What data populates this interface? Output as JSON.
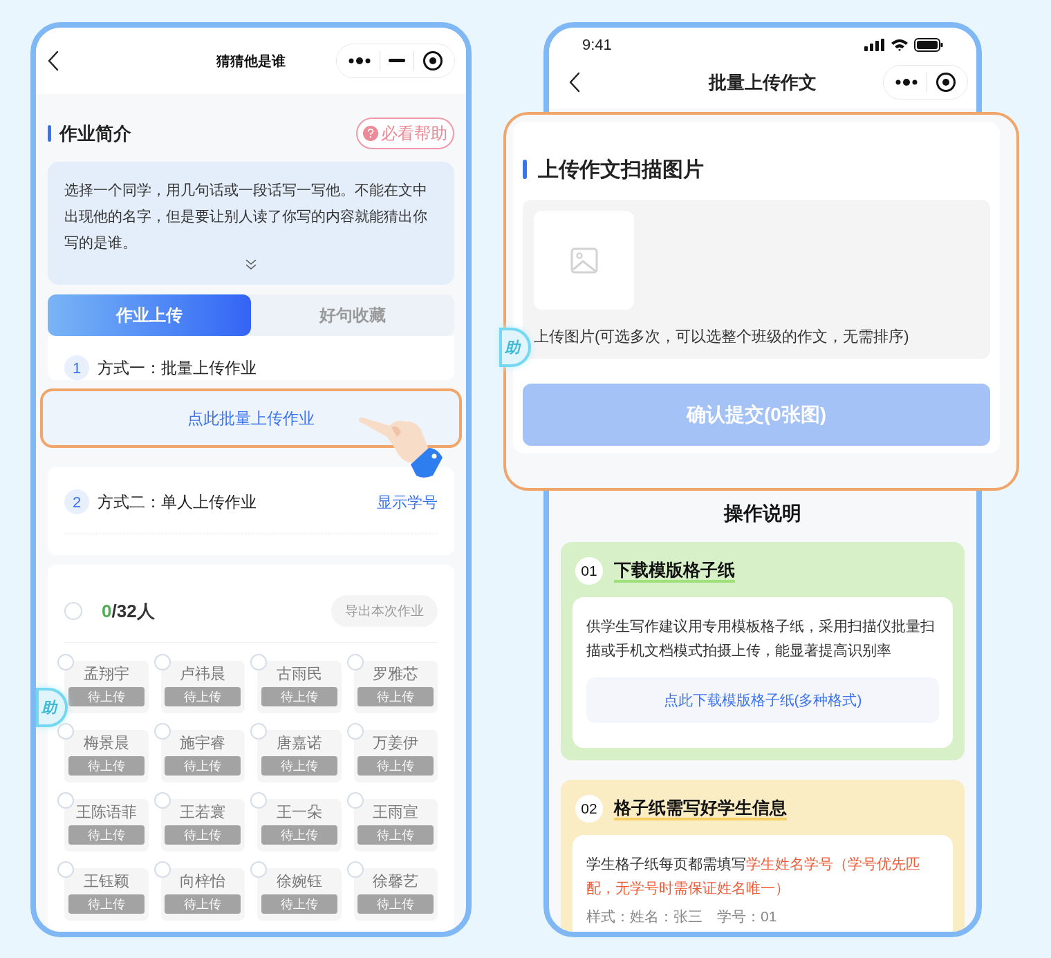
{
  "left_phone": {
    "nav": {
      "title": "猜猜他是谁"
    },
    "intro": {
      "title": "作业简介",
      "help_label": "必看帮助",
      "description": "选择一个同学，用几句话或一段话写一写他。不能在文中出现他的名字，但是要让别人读了你写的内容就能猜出你写的是谁。"
    },
    "tabs": [
      {
        "label": "作业上传",
        "selected": true
      },
      {
        "label": "好句收藏",
        "selected": false
      }
    ],
    "method_one": {
      "number": "1",
      "label": "方式一：批量上传作业",
      "button": "点此批量上传作业"
    },
    "method_two": {
      "number": "2",
      "label": "方式二：单人上传作业",
      "link": "显示学号"
    },
    "summary": {
      "selected": false,
      "done": "0",
      "total": "/32人",
      "export_label": "导出本次作业"
    },
    "students": [
      {
        "name": "孟翔宇",
        "status": "待上传",
        "selected": false
      },
      {
        "name": "卢祎晨",
        "status": "待上传",
        "selected": false
      },
      {
        "name": "古雨民",
        "status": "待上传",
        "selected": false
      },
      {
        "name": "罗雅芯",
        "status": "待上传",
        "selected": false
      },
      {
        "name": "梅景晨",
        "status": "待上传",
        "selected": false
      },
      {
        "name": "施宇睿",
        "status": "待上传",
        "selected": false
      },
      {
        "name": "唐嘉诺",
        "status": "待上传",
        "selected": false
      },
      {
        "name": "万姜伊",
        "status": "待上传",
        "selected": false
      },
      {
        "name": "王陈语菲",
        "status": "待上传",
        "selected": false
      },
      {
        "name": "王若寰",
        "status": "待上传",
        "selected": false
      },
      {
        "name": "王一朵",
        "status": "待上传",
        "selected": false
      },
      {
        "name": "王雨宣",
        "status": "待上传",
        "selected": false
      },
      {
        "name": "王钰颖",
        "status": "待上传",
        "selected": false
      },
      {
        "name": "向梓怡",
        "status": "待上传",
        "selected": false
      },
      {
        "name": "徐婉钰",
        "status": "待上传",
        "selected": false
      },
      {
        "name": "徐馨艺",
        "status": "待上传",
        "selected": false
      }
    ],
    "help_float": "助"
  },
  "right_phone": {
    "status_bar": {
      "time": "9:41"
    },
    "nav": {
      "title": "批量上传作文"
    },
    "upload_card": {
      "title": "上传作文扫描图片",
      "hint": "上传图片(可选多次，可以选整个班级的作文，无需排序)",
      "submit_label": "确认提交(0张图)"
    },
    "help_float": "助",
    "instructions": {
      "title": "操作说明",
      "steps": [
        {
          "number": "01",
          "title": "下载模版格子纸",
          "color": "#d8f0c8",
          "body": [
            {
              "text": "供学生写作建议用专用模板格子纸，采用扫描仪批量扫描或手机文档模式拍摄上传，能显著提高识别率",
              "emphasis": false
            }
          ],
          "link": "点此下载模版格子纸(多种格式)"
        },
        {
          "number": "02",
          "title": "格子纸需写好学生信息",
          "color": "#faecc3",
          "body": [
            {
              "text": "学生格子纸每页都需填写",
              "emphasis": false
            },
            {
              "text": "学生姓名学号（学号优先匹配，无学号时需保证姓名唯一）",
              "emphasis": true
            }
          ],
          "note": "样式：姓名：张三　学号：01"
        }
      ]
    }
  }
}
